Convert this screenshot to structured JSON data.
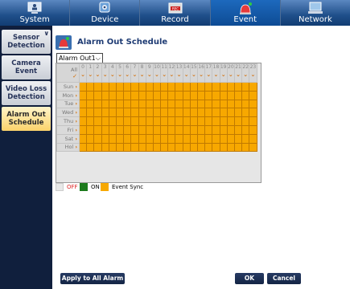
{
  "nav": {
    "tabs": [
      {
        "label": "System",
        "icon": "monitor-person-icon"
      },
      {
        "label": "Device",
        "icon": "camera-icon"
      },
      {
        "label": "Record",
        "icon": "record-icon"
      },
      {
        "label": "Event",
        "icon": "alarm-icon"
      },
      {
        "label": "Network",
        "icon": "network-icon"
      }
    ],
    "active": "Event"
  },
  "sidebar": {
    "items": [
      {
        "label": "Sensor Detection"
      },
      {
        "label": "Camera Event"
      },
      {
        "label": "Video Loss Detection"
      },
      {
        "label": "Alarm Out Schedule"
      }
    ],
    "active": "Alarm Out Schedule"
  },
  "header": {
    "title": "Alarm Out Schedule",
    "icon": "alarm-icon"
  },
  "selector": {
    "value": "Alarm Out1"
  },
  "schedule": {
    "all_label": "All",
    "hours": [
      "0",
      "1",
      "2",
      "3",
      "4",
      "5",
      "6",
      "7",
      "8",
      "9",
      "10",
      "11",
      "12",
      "13",
      "14",
      "15",
      "16",
      "17",
      "18",
      "19",
      "20",
      "21",
      "22",
      "23"
    ],
    "days": [
      "Sun",
      "Mon",
      "Tue",
      "Wed",
      "Thu",
      "Fri",
      "Sat",
      "Hol"
    ],
    "cell_state": "Event Sync"
  },
  "legend": {
    "off": "OFF",
    "on": "ON",
    "event_sync": "Event Sync",
    "colors": {
      "off": "#e8e8e8",
      "on": "#1c7a1c",
      "event_sync": "#f7a800"
    }
  },
  "buttons": {
    "apply_all": "Apply to All Alarm out",
    "ok": "OK",
    "cancel": "Cancel"
  }
}
